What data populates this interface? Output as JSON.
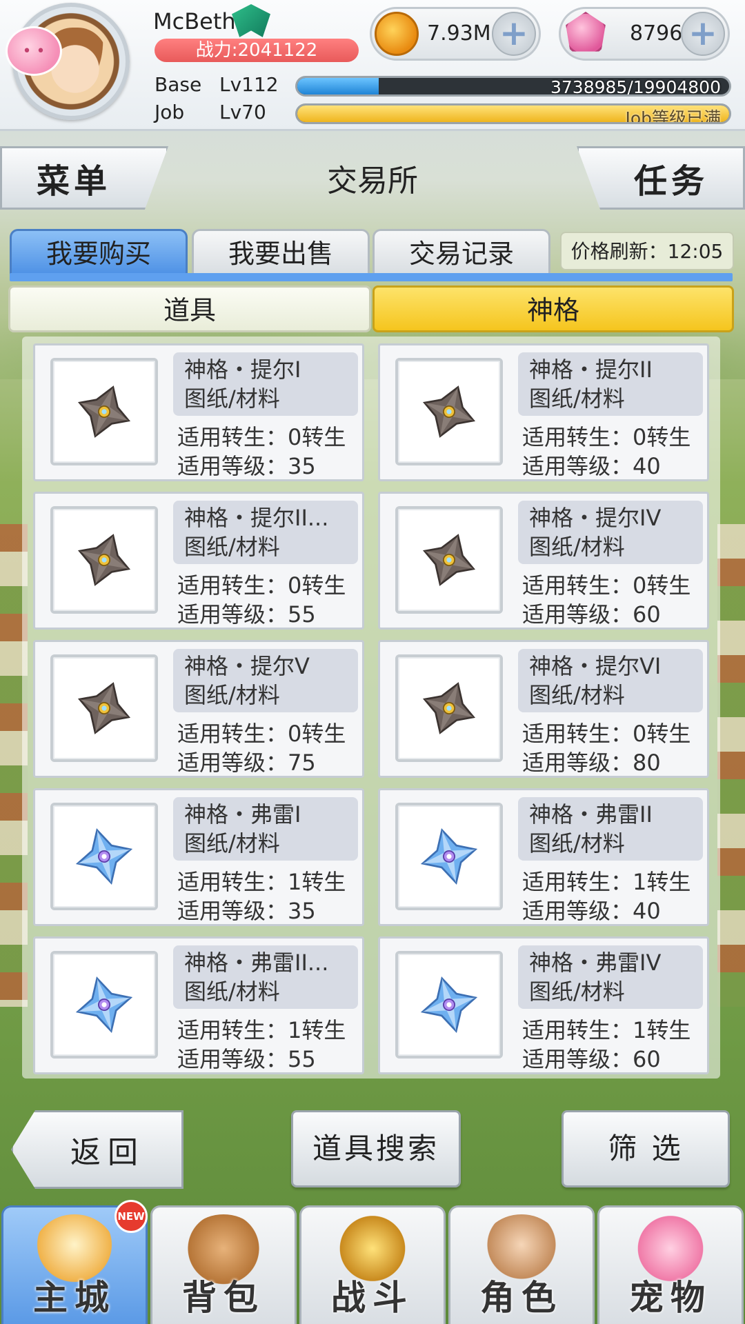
{
  "player": {
    "name": "McBeth",
    "power": "战力:2041122",
    "base_label": "Base",
    "base_level": "Lv112",
    "base_exp": "3738985/19904800",
    "base_exp_fraction": 0.188,
    "job_label": "Job",
    "job_level": "Lv70",
    "job_exp": "Job等级已满",
    "job_exp_fraction": 1.0
  },
  "currency": {
    "zeny": "7.93M",
    "gems": "8796"
  },
  "header": {
    "menu_label": "菜单",
    "title": "交易所",
    "task_label": "任务"
  },
  "tabs": [
    {
      "label": "我要购买",
      "active": true
    },
    {
      "label": "我要出售",
      "active": false
    },
    {
      "label": "交易记录",
      "active": false
    }
  ],
  "refresh_text": "价格刷新：12:05",
  "subtabs": {
    "items": "道具",
    "godhood": "神格"
  },
  "items": [
    {
      "name": "神格・提尔I",
      "type": "图纸/材料",
      "rebirth": "适用转生：0转生",
      "level": "适用等级：35",
      "icon": "tyr-rune-icon"
    },
    {
      "name": "神格・提尔II",
      "type": "图纸/材料",
      "rebirth": "适用转生：0转生",
      "level": "适用等级：40",
      "icon": "tyr-rune-icon"
    },
    {
      "name": "神格・提尔II...",
      "type": "图纸/材料",
      "rebirth": "适用转生：0转生",
      "level": "适用等级：55",
      "icon": "tyr-rune-icon"
    },
    {
      "name": "神格・提尔IV",
      "type": "图纸/材料",
      "rebirth": "适用转生：0转生",
      "level": "适用等级：60",
      "icon": "tyr-rune-icon"
    },
    {
      "name": "神格・提尔V",
      "type": "图纸/材料",
      "rebirth": "适用转生：0转生",
      "level": "适用等级：75",
      "icon": "tyr-rune-icon"
    },
    {
      "name": "神格・提尔VI",
      "type": "图纸/材料",
      "rebirth": "适用转生：0转生",
      "level": "适用等级：80",
      "icon": "tyr-rune-icon"
    },
    {
      "name": "神格・弗雷I",
      "type": "图纸/材料",
      "rebirth": "适用转生：1转生",
      "level": "适用等级：35",
      "icon": "freyr-rune-icon"
    },
    {
      "name": "神格・弗雷II",
      "type": "图纸/材料",
      "rebirth": "适用转生：1转生",
      "level": "适用等级：40",
      "icon": "freyr-rune-icon"
    },
    {
      "name": "神格・弗雷II...",
      "type": "图纸/材料",
      "rebirth": "适用转生：1转生",
      "level": "适用等级：55",
      "icon": "freyr-rune-icon"
    },
    {
      "name": "神格・弗雷IV",
      "type": "图纸/材料",
      "rebirth": "适用转生：1转生",
      "level": "适用等级：60",
      "icon": "freyr-rune-icon"
    }
  ],
  "actions": {
    "back": "返回",
    "search": "道具搜索",
    "filter": "筛 选"
  },
  "nav": [
    {
      "label": "主城",
      "active": true,
      "badge": "NEW"
    },
    {
      "label": "背包",
      "active": false
    },
    {
      "label": "战斗",
      "active": false
    },
    {
      "label": "角色",
      "active": false
    },
    {
      "label": "宠物",
      "active": false
    }
  ],
  "colors": {
    "tyr_stone": "#6e625d",
    "freyr_crystal": "#6fb0f0",
    "tab_active": "#5fa0ef",
    "subtab_active": "#f5c51e",
    "exp_bar": "#2f9be8",
    "job_bar": "#f2c23a"
  }
}
